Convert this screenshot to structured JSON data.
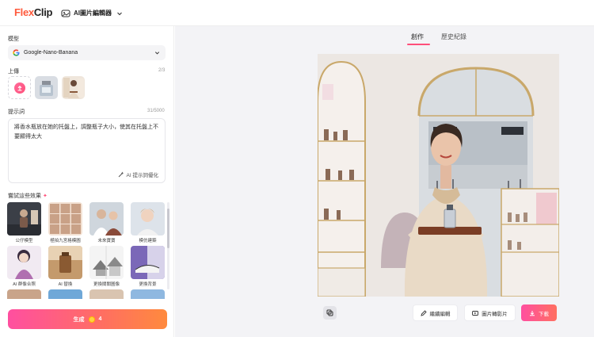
{
  "header": {
    "logo_part1": "Flex",
    "logo_part2": "Clip",
    "tool_name": "AI圖片編輯器"
  },
  "left": {
    "model_label": "模型",
    "model_value": "Google-Nano-Banana",
    "upload_label": "上傳",
    "upload_count": "2/3",
    "prompt_label": "提示詞",
    "prompt_count": "31/5000",
    "prompt_text": "將香水瓶放在她的托盤上，調整瓶子大小，使其在托盤上不要顯得太大",
    "optimize_label": "AI 提示詞優化",
    "effects_label": "嘗試這些效果",
    "effects": [
      {
        "caption": "公仔模型"
      },
      {
        "caption": "極拍九宮格模圖"
      },
      {
        "caption": "未來寶寶"
      },
      {
        "caption": "模仿建築"
      },
      {
        "caption": "AI 群像合照"
      },
      {
        "caption": "AI 替換"
      },
      {
        "caption": "更換關關圖像"
      },
      {
        "caption": "更換背景"
      }
    ],
    "generate_label": "生成",
    "generate_cost": "4"
  },
  "right": {
    "tab_create": "創作",
    "tab_history": "歷史紀錄",
    "continue_edit": "繼續編輯",
    "image_to_video": "圖片轉影片",
    "download": "下載"
  },
  "colors": {
    "accent": "#ff4f7a",
    "logo_orange": "#ff5a3c",
    "panel_bg": "#f3f3f6"
  }
}
